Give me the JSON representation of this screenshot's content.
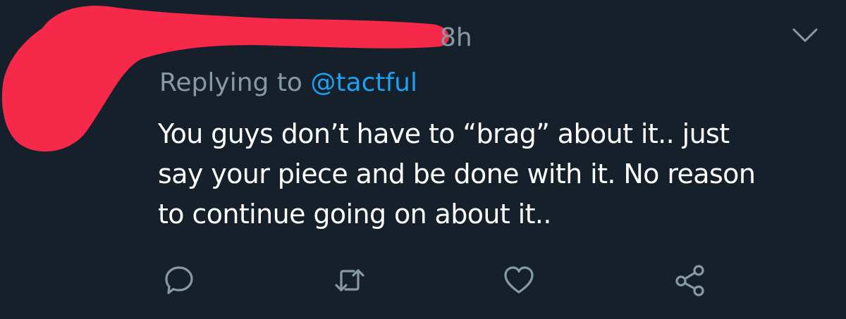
{
  "tweet": {
    "timestamp": "8h",
    "replying_prefix": "Replying to ",
    "replying_handle": "@tactful",
    "text_lines": [
      "You guys don’t have to “brag” about it.. just",
      "say your piece and be done with it. No reason",
      "to continue going on about it.."
    ]
  },
  "icons": {
    "menu": "chevron-down-icon",
    "reply": "reply-icon",
    "retweet": "retweet-icon",
    "like": "heart-icon",
    "share": "share-icon",
    "redaction": "red-marker-redaction"
  },
  "colors": {
    "background": "#15202b",
    "secondary_text": "#8899a6",
    "link": "#1da1f2",
    "primary_text": "#ffffff",
    "redaction": "#f7294a"
  }
}
